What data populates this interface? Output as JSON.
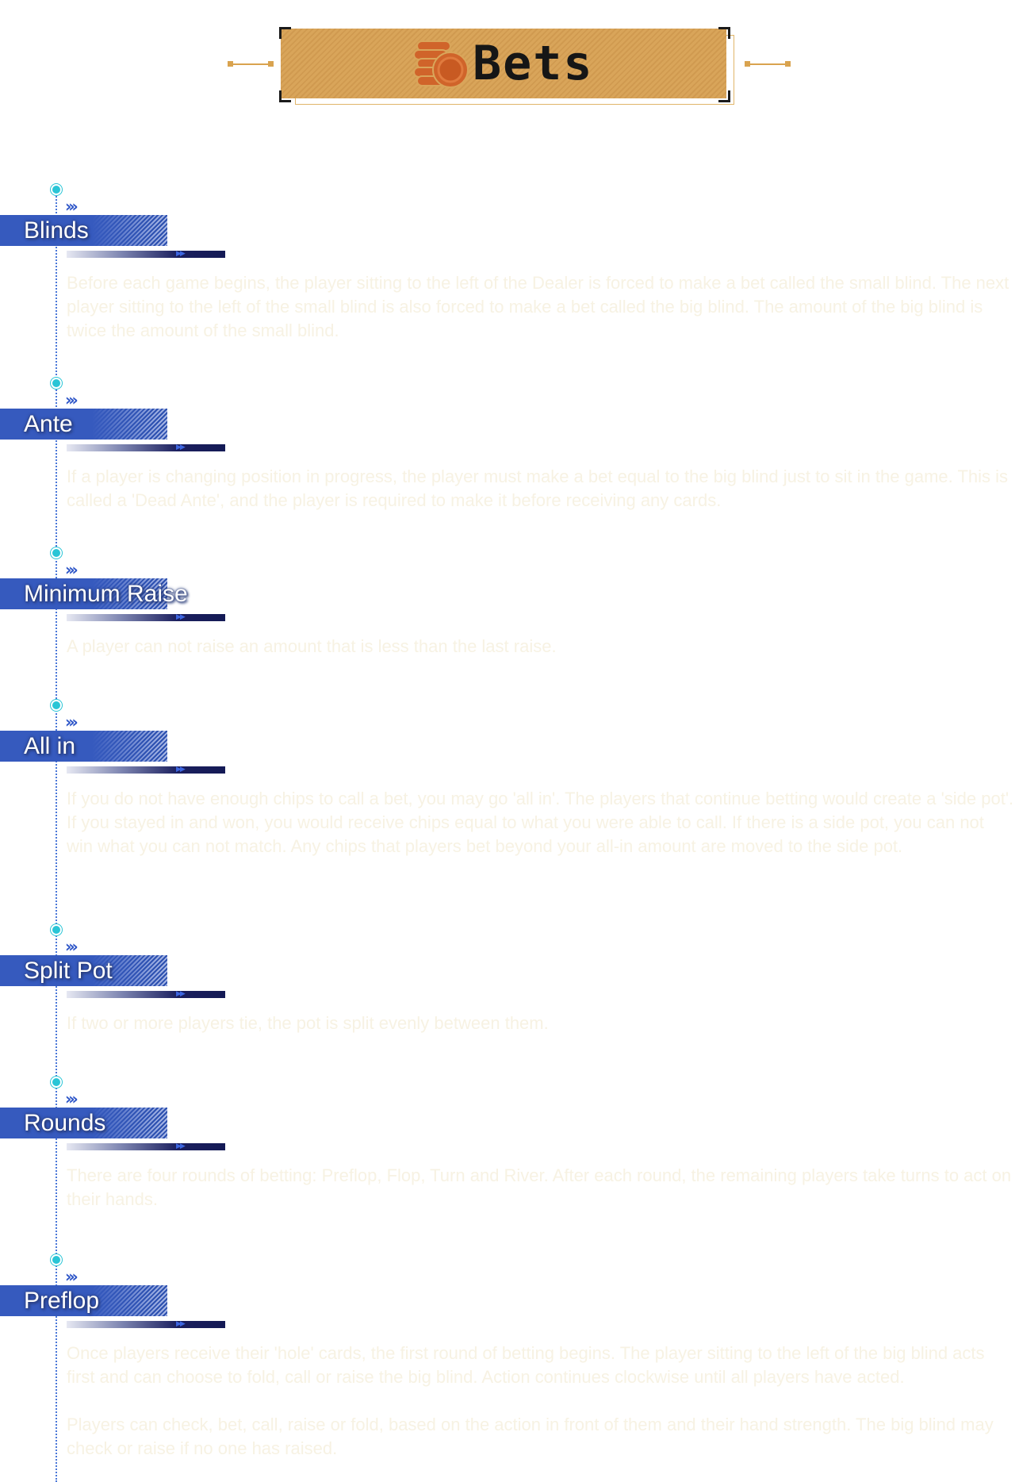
{
  "header": {
    "title": "Bets",
    "icon": "coins-icon",
    "colors": {
      "banner": "#d9a55a",
      "accent": "#d9a34f",
      "coin": "#d0642a"
    }
  },
  "timeline": {
    "colors": {
      "node": "#29c5d6",
      "label_bar": "#365abe",
      "line": "#4a77d8"
    },
    "sections": [
      {
        "title": "Blinds",
        "paragraphs": [
          "Before each game begins, the player sitting to the left of the Dealer is forced to make a bet called the small blind. The next player sitting to the left of the small blind is also forced to make a bet called the big blind. The amount of the big blind is twice the amount of the small blind."
        ]
      },
      {
        "title": "Ante",
        "paragraphs": [
          "If a player is changing position in progress, the player must make a bet equal to the big blind just to sit in the game. This is called a 'Dead Ante', and the player is required to make it before receiving any cards."
        ]
      },
      {
        "title": "Minimum Raise",
        "paragraphs": [
          "A player can not raise an amount that is less than the last raise."
        ]
      },
      {
        "title": "All in",
        "paragraphs": [
          "If you do not have enough chips to call a bet, you may go 'all in'. The players that continue betting would create a 'side pot'. If you stayed in and won, you would receive chips equal to what you were able to call. If there is a side pot, you can not win what you can not match. Any chips that players bet beyond your all-in amount are moved to the side pot."
        ]
      },
      {
        "title": "Split Pot",
        "paragraphs": [
          "If two or more players tie, the pot is split evenly between them."
        ]
      },
      {
        "title": "Rounds",
        "paragraphs": [
          "There are four rounds of betting: Preflop, Flop, Turn and River. After each round, the remaining players take turns to act on their hands."
        ]
      },
      {
        "title": "Preflop",
        "paragraphs": [
          "Once players receive their 'hole' cards, the first round of betting begins. The player sitting to the left of the big blind acts first and can choose to fold, call or raise the big blind. Action continues clockwise until all players have acted.",
          "Players can check, bet, call, raise or fold, based on the action in front of them and their hand strength. The big blind may check or raise if no one has raised."
        ]
      }
    ]
  }
}
